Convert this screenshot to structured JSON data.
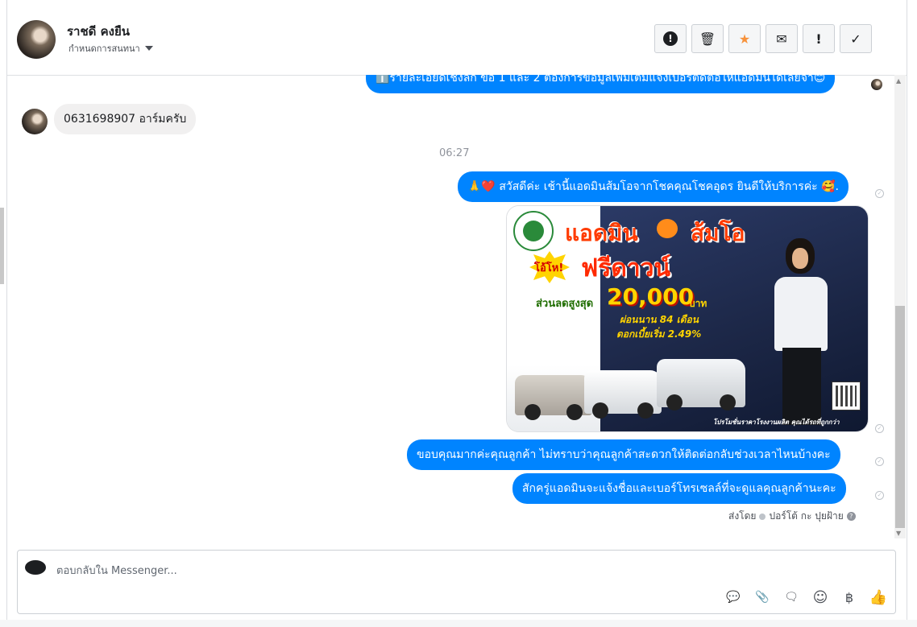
{
  "header": {
    "name": "ราชดี คงยืน",
    "subtitle": "กำหนดการสนทนา",
    "actions": [
      {
        "icon": "spam-icon",
        "glyph": "!"
      },
      {
        "icon": "trash-icon",
        "glyph": "🗑"
      },
      {
        "icon": "star-icon",
        "glyph": "★"
      },
      {
        "icon": "mail-icon",
        "glyph": "✉"
      },
      {
        "icon": "important-icon",
        "glyph": "!"
      },
      {
        "icon": "done-icon",
        "glyph": "✓"
      }
    ]
  },
  "messages": {
    "cut_top": "ℹ️รายละเอียดเชิงลึก ข้อ 1 และ 2 ต้องการข้อมูลเพิ่มเติมแจ้งเบอร์ติดต่อให้แอดมินได้เลยจ้า😊",
    "incoming_1": "0631698907 อาร์มครับ",
    "time": "06:27",
    "outgoing_1": "🙏❤️ สวัสดีค่ะ เช้านี้แอดมินส้มโอจากโชคคุณโชคอุดร ยินดีให้บริการค่ะ 🥰.",
    "outgoing_2": "ขอบคุณมากค่ะคุณลูกค้า ไม่ทราบว่าคุณลูกค้าสะดวกให้ติดต่อกลับช่วงเวลาไหนบ้างคะ",
    "outgoing_3": "สักครู่แอดมินจะแจ้งชื่อและเบอร์โทรเซลล์ที่จะดูแลคุณลูกค้านะคะ",
    "sent_by": "ส่งโดย",
    "sent_by_name": "ปอร์โต้ กะ ปุยฝ้าย",
    "help_glyph": "?"
  },
  "image_ad": {
    "title_left": "แอดมิน",
    "title_right": "ส้มโอ",
    "burst": "โอ้โห!",
    "free": "ฟรีดาวน์",
    "discount_label": "ส่วนลดสูงสุด",
    "discount_value": "20,000",
    "discount_unit": "บาท",
    "promo_1": "ผ่อนนาน 84 เดือน",
    "promo_2": "ดอกเบี้ยเริ่ม 2.49%",
    "footer": "โปรโมชั่นราคาโรงงานผลิต คุณได้รถที่ถูกกว่า"
  },
  "composer": {
    "placeholder": "ตอบกลับใน Messenger...",
    "tools": [
      {
        "icon": "saved-reply-icon",
        "glyph": "💬"
      },
      {
        "icon": "attachment-icon",
        "glyph": "📎"
      },
      {
        "icon": "chat-icon",
        "glyph": "🗨"
      },
      {
        "icon": "emoji-icon",
        "glyph": "☺"
      },
      {
        "icon": "payment-icon",
        "glyph": "฿"
      },
      {
        "icon": "like-icon",
        "glyph": "👍"
      }
    ]
  },
  "colors": {
    "accent": "#0084ff",
    "incoming_bubble": "#f1f0f0",
    "star": "#f7923b"
  }
}
